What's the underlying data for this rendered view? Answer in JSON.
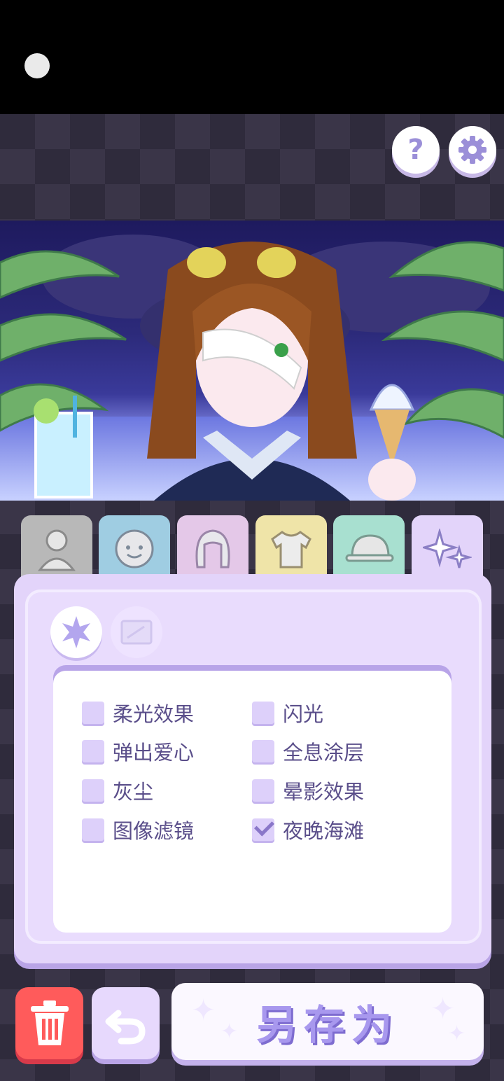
{
  "top_bar": {
    "help_symbol": "?",
    "help_icon": "question-mark-icon",
    "settings_icon": "gear-icon"
  },
  "tabs": [
    {
      "icon": "silhouette-icon",
      "color": "#b8b8b8"
    },
    {
      "icon": "face-icon",
      "color": "#9fcde2"
    },
    {
      "icon": "hair-icon",
      "color": "#e4c8e8"
    },
    {
      "icon": "shirt-icon",
      "color": "#efe4a8"
    },
    {
      "icon": "cap-icon",
      "color": "#a8e0d0"
    },
    {
      "icon": "sparkles-icon",
      "color": "#e3d4fa",
      "active": true
    }
  ],
  "subtabs": [
    {
      "icon": "star-burst-icon",
      "active": true
    },
    {
      "icon": "frame-icon",
      "active": false
    }
  ],
  "effects": {
    "left": [
      {
        "label": "柔光效果",
        "checked": false
      },
      {
        "label": "弹出爱心",
        "checked": false
      },
      {
        "label": "灰尘",
        "checked": false
      },
      {
        "label": "图像滤镜",
        "checked": false
      }
    ],
    "right": [
      {
        "label": "闪光",
        "checked": false
      },
      {
        "label": "全息涂层",
        "checked": false
      },
      {
        "label": "晕影效果",
        "checked": false
      },
      {
        "label": "夜晚海滩",
        "checked": true
      }
    ]
  },
  "bottom_bar": {
    "trash_icon": "trash-icon",
    "undo_icon": "undo-icon",
    "save_label": "另存为"
  },
  "colors": {
    "accent": "#9b8fd8",
    "panel": "#e3d4fa",
    "danger": "#ff5b5b"
  }
}
